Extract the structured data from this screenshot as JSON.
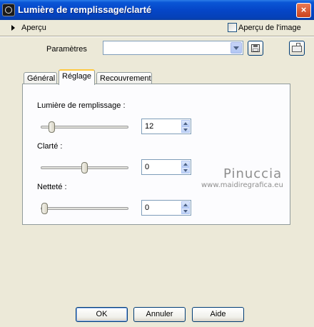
{
  "window": {
    "title": "Lumière de remplissage/clarté",
    "close_glyph": "×"
  },
  "top": {
    "apercu_label": "Aperçu",
    "apercu_image_label": "Aperçu de l'image",
    "apercu_image_checked": false
  },
  "params": {
    "label": "Paramètres",
    "value": ""
  },
  "tabs": [
    {
      "label": "Général",
      "active": false
    },
    {
      "label": "Réglage",
      "active": true
    },
    {
      "label": "Recouvrement",
      "active": false
    }
  ],
  "fields": [
    {
      "label": "Lumière de remplissage :",
      "value": "12"
    },
    {
      "label": "Clarté :",
      "value": "0"
    },
    {
      "label": "Netteté :",
      "value": "0"
    }
  ],
  "watermark": {
    "name": "Pinuccia",
    "url": "www.maidiregrafica.eu"
  },
  "buttons": {
    "ok": "OK",
    "cancel": "Annuler",
    "help": "Aide"
  },
  "colors": {
    "titlebar": "#0546c8",
    "dialog_bg": "#ece9d8",
    "panel_bg": "#fcfcfe",
    "tab_active_accent": "#ffc83c"
  },
  "icons": {
    "app": "app-icon",
    "close": "close-icon",
    "expand": "caret-right-icon",
    "save": "save-icon",
    "load": "load-preset-icon"
  }
}
